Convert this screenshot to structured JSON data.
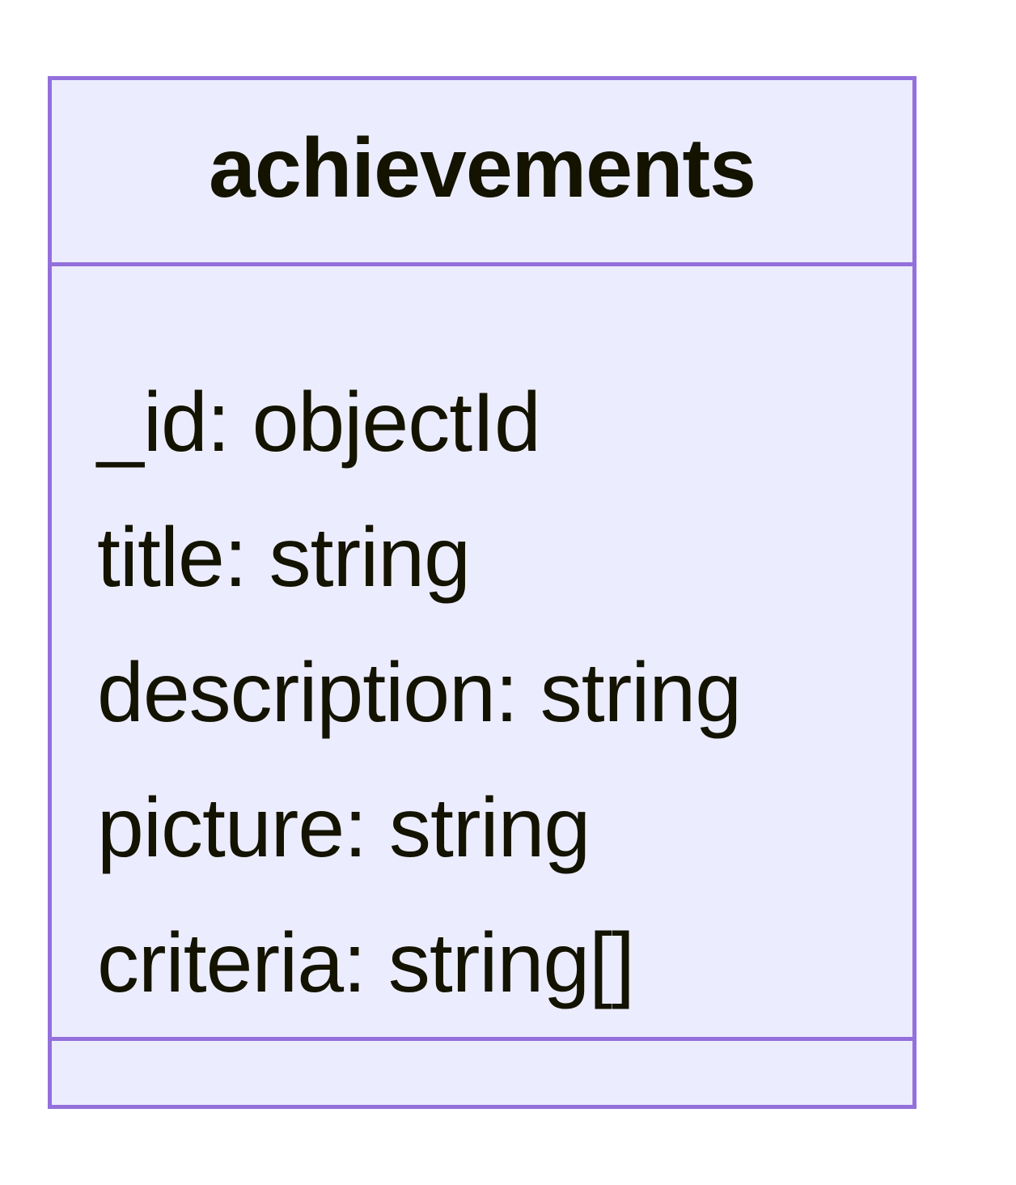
{
  "diagram": {
    "type": "uml-class",
    "class_name": "achievements",
    "attributes": [
      "_id: objectId",
      "title: string",
      "description: string",
      "picture: string",
      "criteria: string[]"
    ],
    "methods": [],
    "colors": {
      "border": "#9370DB",
      "fill": "#ECECFF",
      "text": "#131300"
    }
  }
}
